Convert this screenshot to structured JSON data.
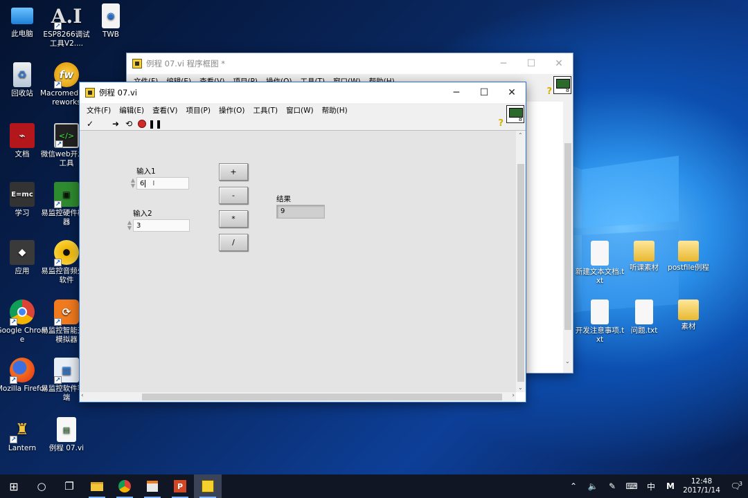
{
  "desktop": {
    "icons": [
      {
        "label": "此电脑",
        "icon": "this-pc-icon",
        "shortcut": false
      },
      {
        "label": "ESP8266调试工具V2....",
        "icon": "ai-app-icon",
        "shortcut": true
      },
      {
        "label": "TWB",
        "icon": "twb-file-icon",
        "shortcut": false
      },
      {
        "label": "回收站",
        "icon": "recycle-bin-icon",
        "shortcut": false
      },
      {
        "label": "Macromedia Fireworks",
        "icon": "fireworks-icon",
        "shortcut": true
      },
      {
        "label": "文档",
        "icon": "pdf-document-icon",
        "shortcut": false
      },
      {
        "label": "微信web开发者工具",
        "icon": "wechat-devtools-icon",
        "shortcut": true
      },
      {
        "label": "学习",
        "icon": "emc-folder-icon",
        "shortcut": false
      },
      {
        "label": "易监控硬件模拟器",
        "icon": "chip-icon",
        "shortcut": true
      },
      {
        "label": "应用",
        "icon": "apps-icon",
        "shortcut": false
      },
      {
        "label": "易监控音频处理软件",
        "icon": "audio-disc-icon",
        "shortcut": true
      },
      {
        "label": "Google Chrome",
        "icon": "chrome-icon",
        "shortcut": true
      },
      {
        "label": "易监控智能开关模拟器",
        "icon": "switch-sim-icon",
        "shortcut": true
      },
      {
        "label": "Mozilla Firefox",
        "icon": "firefox-icon",
        "shortcut": true
      },
      {
        "label": "易监控软件客户端",
        "icon": "client-app-icon",
        "shortcut": true
      },
      {
        "label": "Lantern",
        "icon": "lantern-icon",
        "shortcut": true
      },
      {
        "label": "例程 07.vi",
        "icon": "vi-file-icon",
        "shortcut": false
      }
    ],
    "right_icons": [
      {
        "label": "新建文本文档.txt",
        "icon": "text-file-icon"
      },
      {
        "label": "听课素材",
        "icon": "folder-icon"
      },
      {
        "label": "postfile例程",
        "icon": "folder-icon"
      },
      {
        "label": "开发注意事项.txt",
        "icon": "text-file-icon"
      },
      {
        "label": "问题.txt",
        "icon": "text-file-icon"
      },
      {
        "label": "素材",
        "icon": "folder-icon"
      }
    ]
  },
  "block_diagram_window": {
    "title": "例程 07.vi 程序框图 *",
    "menu": [
      "文件(F)",
      "编辑(E)",
      "查看(V)",
      "项目(P)",
      "操作(O)",
      "工具(T)",
      "窗口(W)",
      "帮助(H)"
    ]
  },
  "front_panel_window": {
    "title": "例程 07.vi",
    "menu": [
      "文件(F)",
      "编辑(E)",
      "查看(V)",
      "项目(P)",
      "操作(O)",
      "工具(T)",
      "窗口(W)",
      "帮助(H)"
    ],
    "toolbar": [
      "checkmark-icon",
      "run-arrow-icon",
      "run-continuous-icon",
      "abort-icon",
      "pause-icon"
    ],
    "input1": {
      "label": "输入1",
      "value": "6"
    },
    "input2": {
      "label": "输入2",
      "value": "3"
    },
    "buttons": [
      "+",
      "-",
      "*",
      "/"
    ],
    "result": {
      "label": "结果",
      "value": "9"
    }
  },
  "taskbar": {
    "items": [
      "start-icon",
      "cortana-icon",
      "task-view-icon",
      "file-explorer-icon",
      "chrome-icon",
      "store-icon",
      "powerpoint-icon",
      "labview-icon"
    ],
    "tray": {
      "ime": "中",
      "ime2": "M",
      "time": "12:48",
      "date": "2017/1/14",
      "notifications": "3"
    }
  },
  "colors": {
    "accent": "#0078d7",
    "desktop": "#0c4fb0",
    "panel": "#e4e4e4"
  }
}
